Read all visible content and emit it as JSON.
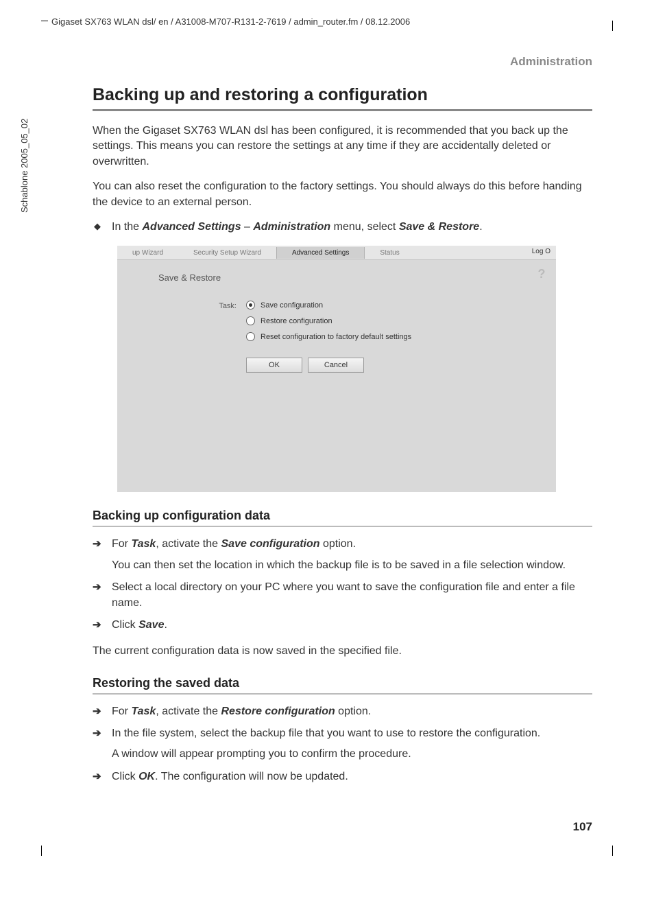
{
  "header_path": "Gigaset SX763 WLAN dsl/ en / A31008-M707-R131-2-7619 / admin_router.fm / 08.12.2006",
  "vertical_label": "Schablone 2005_05_02",
  "section_label": "Administration",
  "page_number": "107",
  "h1": "Backing up and restoring a configuration",
  "intro_p1": "When the Gigaset SX763 WLAN dsl has been configured, it is recommended that you back up the settings. This means you can restore the settings at any time if they are accidentally deleted or overwritten.",
  "intro_p2": "You can also reset the configuration to the factory settings. You should always do this before handing the device to an external person.",
  "nav_instruction": {
    "prefix": "In the ",
    "b1": "Advanced Settings",
    "sep": " – ",
    "b2": "Administration",
    "mid": " menu, select ",
    "b3": "Save & Restore",
    "suffix": "."
  },
  "screenshot": {
    "tabs": {
      "t1": "up Wizard",
      "t2": "Security Setup Wizard",
      "t3_active": "Advanced Settings",
      "t4": "Status"
    },
    "log_off": "Log O",
    "panel_title": "Save & Restore",
    "help_icon": "?",
    "task_label": "Task:",
    "options": {
      "o1": "Save configuration",
      "o2": "Restore configuration",
      "o3": "Reset configuration to factory default settings"
    },
    "buttons": {
      "ok": "OK",
      "cancel": "Cancel"
    }
  },
  "h2a": "Backing up configuration data",
  "backup_steps": {
    "s1_pre": "For ",
    "s1_b1": "Task",
    "s1_mid": ", activate the ",
    "s1_b2": "Save configuration",
    "s1_post": " option.",
    "s1_sub": "You can then set the location in which the backup file is to be saved in a file selection window.",
    "s2": "Select a local directory on your PC where you want to save the configuration file and enter a file name.",
    "s3_pre": "Click ",
    "s3_b": "Save",
    "s3_post": "."
  },
  "backup_result": "The current configuration data is now saved in the specified file.",
  "h2b": "Restoring the saved data",
  "restore_steps": {
    "s1_pre": "For ",
    "s1_b1": "Task",
    "s1_mid": ", activate the ",
    "s1_b2": "Restore configuration",
    "s1_post": " option.",
    "s2": "In the file system, select the backup file that you want to use to restore the configuration.",
    "s2_sub": "A window will appear prompting you to confirm the procedure.",
    "s3_pre": "Click ",
    "s3_b": "OK",
    "s3_post": ". The configuration will now be updated."
  }
}
